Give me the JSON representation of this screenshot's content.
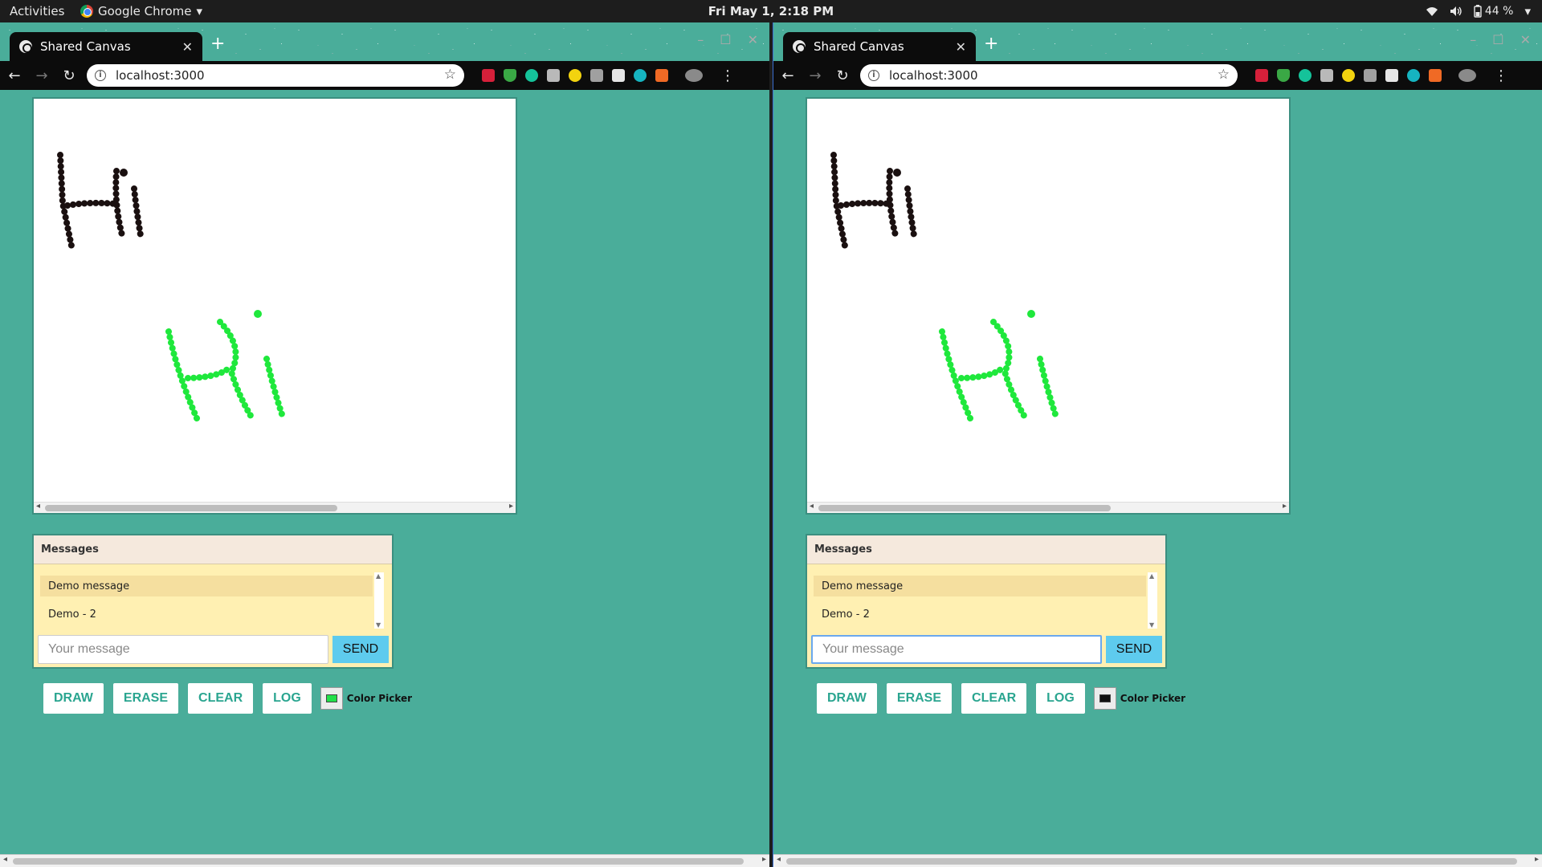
{
  "topbar": {
    "activities": "Activities",
    "app_name": "Google Chrome",
    "app_menu_arrow": "▾",
    "clock": "Fri May  1,  2:18 PM",
    "battery": "44 %"
  },
  "browser": {
    "tab_title": "Shared Canvas",
    "url": "localhost:3000"
  },
  "page": {
    "messages_title": "Messages",
    "messages": [
      "Demo message",
      "Demo - 2"
    ],
    "input_placeholder": "Your message",
    "send_label": "SEND",
    "buttons": {
      "draw": "DRAW",
      "erase": "ERASE",
      "clear": "CLEAR",
      "log": "LOG"
    },
    "color_picker_label": "Color Picker"
  },
  "windows": {
    "left": {
      "picker_color": "#22e04a",
      "input_focused": false
    },
    "right": {
      "picker_color": "#111111",
      "input_focused": true
    }
  },
  "colors": {
    "page_bg": "#4aad9a",
    "ink_black": "#1a1010",
    "ink_green": "#1fe83c",
    "send_bg": "#5ecbee",
    "button_text": "#2aa590"
  }
}
